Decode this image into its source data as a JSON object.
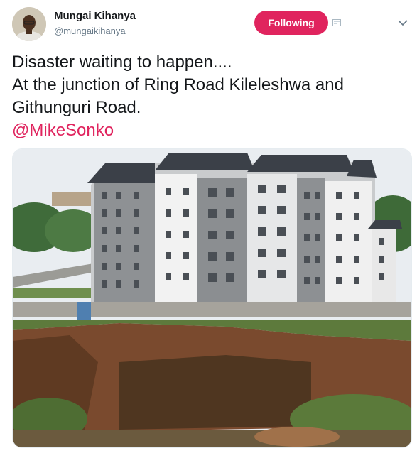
{
  "tweet": {
    "author_name": "Mungai Kihanya",
    "author_handle": "@mungaikihanya",
    "follow_label": "Following",
    "text_lines": [
      "Disaster waiting to happen....",
      "At the junction of Ring Road Kileleshwa and",
      "Githunguri Road."
    ],
    "mention": "@MikeSonko"
  },
  "icons": {
    "avatar": "avatar-photo",
    "notification": "notification-icon",
    "menu": "chevron-down-icon"
  },
  "colors": {
    "follow_button": "#e0245e",
    "mention": "#e0245e",
    "handle": "#657786"
  }
}
